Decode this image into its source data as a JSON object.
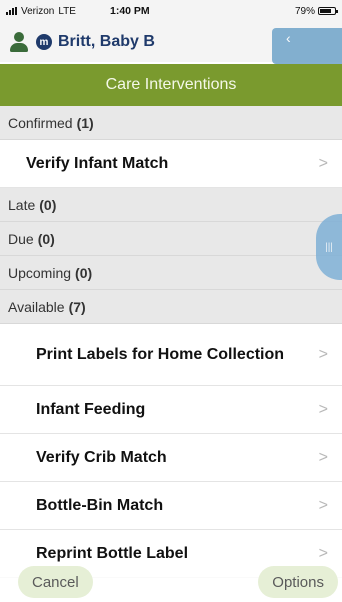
{
  "status_bar": {
    "carrier": "Verizon",
    "network": "LTE",
    "time": "1:40 PM",
    "battery": "79%"
  },
  "patient": {
    "badge": "m",
    "name": "Britt, Baby B"
  },
  "screen_title": "Care Interventions",
  "sections": {
    "confirmed": {
      "label": "Confirmed",
      "count": "(1)"
    },
    "late": {
      "label": "Late",
      "count": "(0)"
    },
    "due": {
      "label": "Due",
      "count": "(0)"
    },
    "upcoming": {
      "label": "Upcoming",
      "count": "(0)"
    },
    "available": {
      "label": "Available",
      "count": "(7)"
    }
  },
  "items": {
    "verify_infant_match": "Verify Infant Match",
    "print_labels": "Print Labels for Home Collection",
    "infant_feeding": "Infant Feeding",
    "verify_crib_match": "Verify Crib Match",
    "bottle_bin_match": "Bottle-Bin Match",
    "reprint_bottle_label": "Reprint Bottle Label"
  },
  "chevron": ">",
  "buttons": {
    "cancel": "Cancel",
    "options": "Options"
  },
  "colors": {
    "title_bar": "#7a9a2e",
    "patient_name": "#1f3a6b",
    "pill_button": "#e6efd6"
  }
}
